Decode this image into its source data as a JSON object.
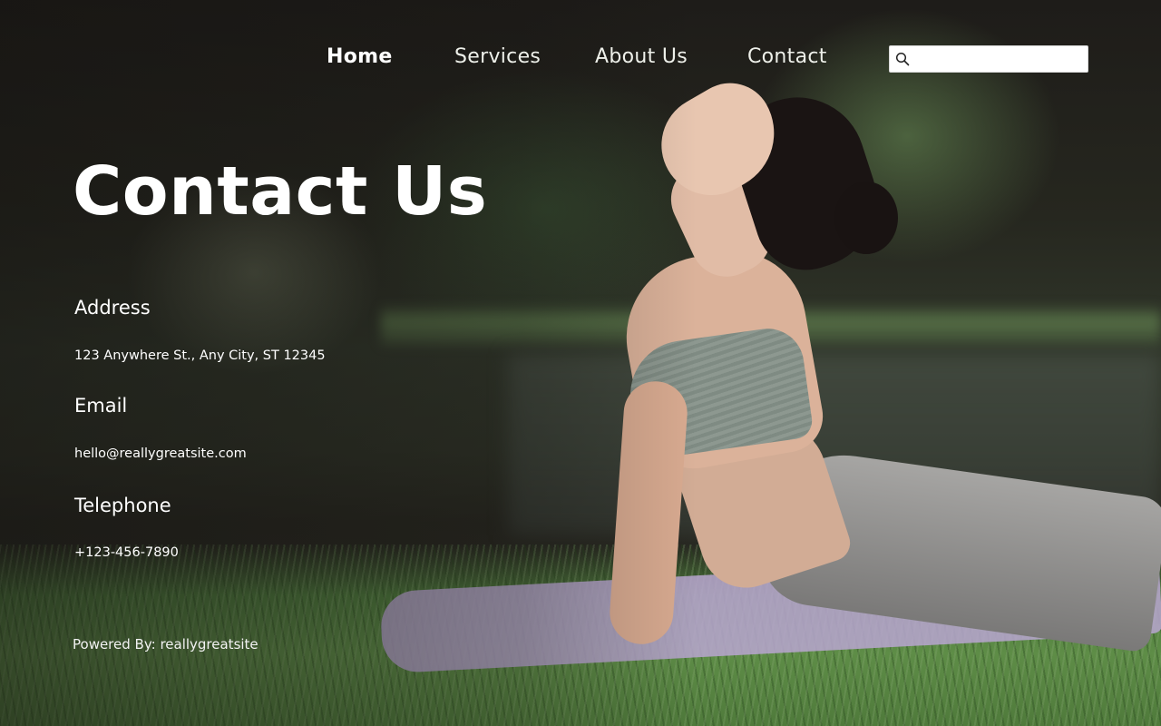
{
  "nav": {
    "items": [
      {
        "label": "Home",
        "active": true
      },
      {
        "label": "Services",
        "active": false
      },
      {
        "label": "About Us",
        "active": false
      },
      {
        "label": "Contact",
        "active": false
      }
    ]
  },
  "search": {
    "icon": "search-icon",
    "value": "",
    "placeholder": ""
  },
  "page": {
    "title": "Contact Us"
  },
  "contact": {
    "address_heading": "Address",
    "address_value": "123 Anywhere St., Any City, ST 12345",
    "email_heading": "Email",
    "email_value": "hello@reallygreatsite.com",
    "phone_heading": "Telephone",
    "phone_value": "+123-456-7890"
  },
  "footer": {
    "text": "Powered By: reallygreatsite"
  },
  "colors": {
    "text": "#ffffff",
    "search_bg": "#ffffff"
  }
}
